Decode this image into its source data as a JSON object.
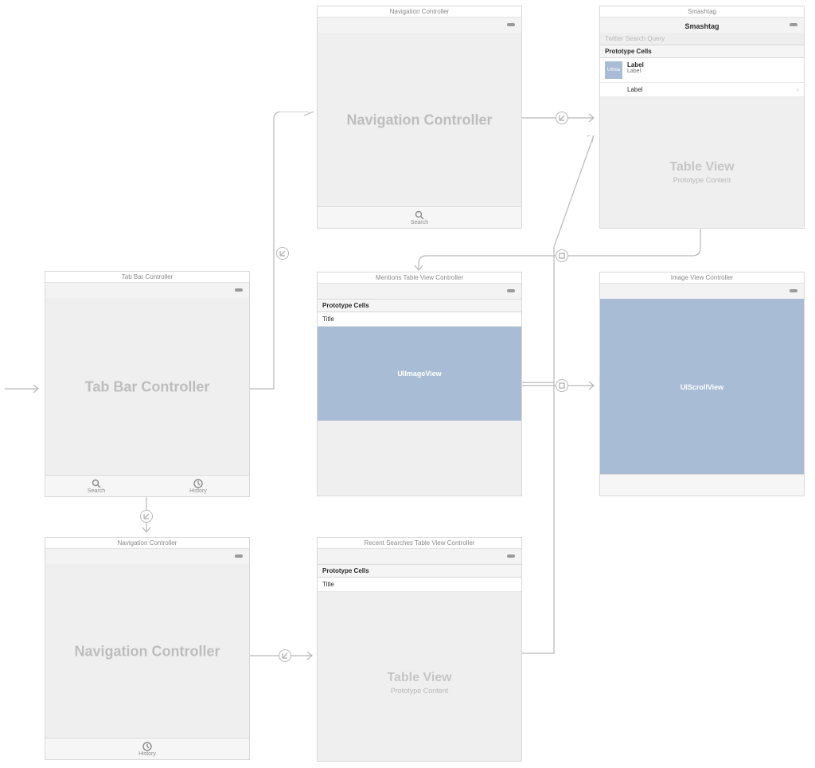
{
  "tabbar_controller": {
    "title": "Tab Bar Controller",
    "big_label": "Tab Bar Controller",
    "tabs": [
      {
        "label": "Search",
        "icon": "search-icon"
      },
      {
        "label": "History",
        "icon": "history-icon"
      }
    ]
  },
  "nav_top": {
    "title": "Navigation Controller",
    "big_label": "Navigation Controller",
    "tabs": [
      {
        "label": "Search",
        "icon": "search-icon"
      }
    ]
  },
  "nav_bottom": {
    "title": "Navigation Controller",
    "big_label": "Navigation Controller",
    "tabs": [
      {
        "label": "History",
        "icon": "history-icon"
      }
    ]
  },
  "smashtag": {
    "title": "Smashtag",
    "nav_title": "Smashtag",
    "search_placeholder": "Twitter Search Query",
    "prototype_header": "Prototype Cells",
    "tweet_cell": {
      "image_label": "UIIma",
      "line1": "Label",
      "line2": "Label"
    },
    "detail_cell": {
      "label": "Label"
    },
    "placeholder_big": "Table View",
    "placeholder_sub": "Prototype Content"
  },
  "mentions": {
    "title": "Mentions Table View Controller",
    "prototype_header": "Prototype Cells",
    "title_cell": "Title",
    "image_cell_label": "UIImageView"
  },
  "recent": {
    "title": "Recent Searches Table View Controller",
    "prototype_header": "Prototype Cells",
    "title_cell": "Title",
    "placeholder_big": "Table View",
    "placeholder_sub": "Prototype Content"
  },
  "imagevc": {
    "title": "Image View Controller",
    "scroll_label": "UIScrollView"
  }
}
